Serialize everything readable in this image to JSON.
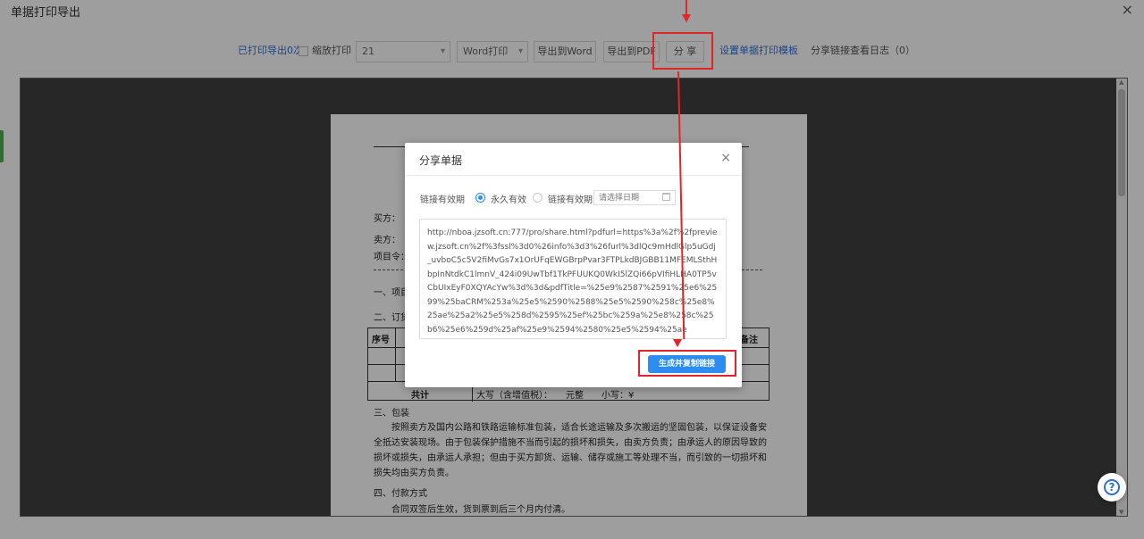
{
  "window": {
    "title": "单据打印导出",
    "close": "×"
  },
  "toolbar": {
    "printed_count": "已打印导出0次",
    "scale_print": "缩放打印",
    "page_select": "21",
    "format_select": "Word打印",
    "export_word": "导出到Word",
    "export_pdf": "导出到PDF",
    "share": "分 享",
    "set_template": "设置单据打印模板",
    "share_log": "分享链接查看日志（0）",
    "caret": "▾"
  },
  "document": {
    "buyer": "买方：",
    "seller": "卖方：",
    "project_no": "项目令：",
    "section1": "一、项目",
    "section2": "二、订货",
    "col_no": "序号",
    "col_remark": "备注",
    "total": "共计",
    "amount": "大写（含增值税）：　　元整　　小写：¥",
    "section3": "三、包装",
    "packaging_text": "按照卖方及国内公路和铁路运输标准包装，适合长途运输及多次搬运的坚固包装，以保证设备安全抵达安装现场。由于包装保护措施不当而引起的损坏和损失，由卖方负责；由承运人的原因导致的损坏或损失，由承运人承担；但由于买方卸货、运输、储存或施工等处理不当，而引致的一切损坏和损失均由买方负责。",
    "section4": "四、付款方式",
    "payment_text": "合同双签后生效，货到票到后三个月内付清。"
  },
  "modal": {
    "title": "分享单据",
    "close": "×",
    "validity_label": "链接有效期",
    "option_permanent": "永久有效",
    "option_period": "链接有效期",
    "date_placeholder": "请选择日期",
    "link": "http://nboa.jzsoft.cn:777/pro/share.html?pdfurl=https%3a%2f%2fpreview.jzsoft.cn%2f%3fssl%3d0%26info%3d3%26furl%3dlQc9mHdlGlp5uGdj_uvboC5c5V2fiMvGs7x1OrUFqEWGBrpPvar3FTPLkdBJGBB11MFEMLSthHbpInNtdkC1lmnV_424i09UwTbf1TkPFUUKQ0WkI5lZQi66pVIfiHLHA0TP5vCbUIxEyF0XQYAcYw%3d%3d&pdfTitle=%25e9%2587%2591%25e6%2599%25baCRM%253a%25e5%2590%2588%25e5%2590%258c%25e8%25ae%25a2%25e5%258d%2595%25ef%25bc%259a%25e8%258c%25b6%25e6%259d%25af%25e9%2594%2580%25e5%2594%25ae",
    "generate_button": "生成并复制链接"
  },
  "scrollbar": {
    "up": "▲",
    "down": "▼"
  },
  "help": {
    "icon": "?"
  },
  "colors": {
    "accent": "#2d8cf0",
    "annotation": "#e0262b",
    "link": "#2f6fd8"
  }
}
